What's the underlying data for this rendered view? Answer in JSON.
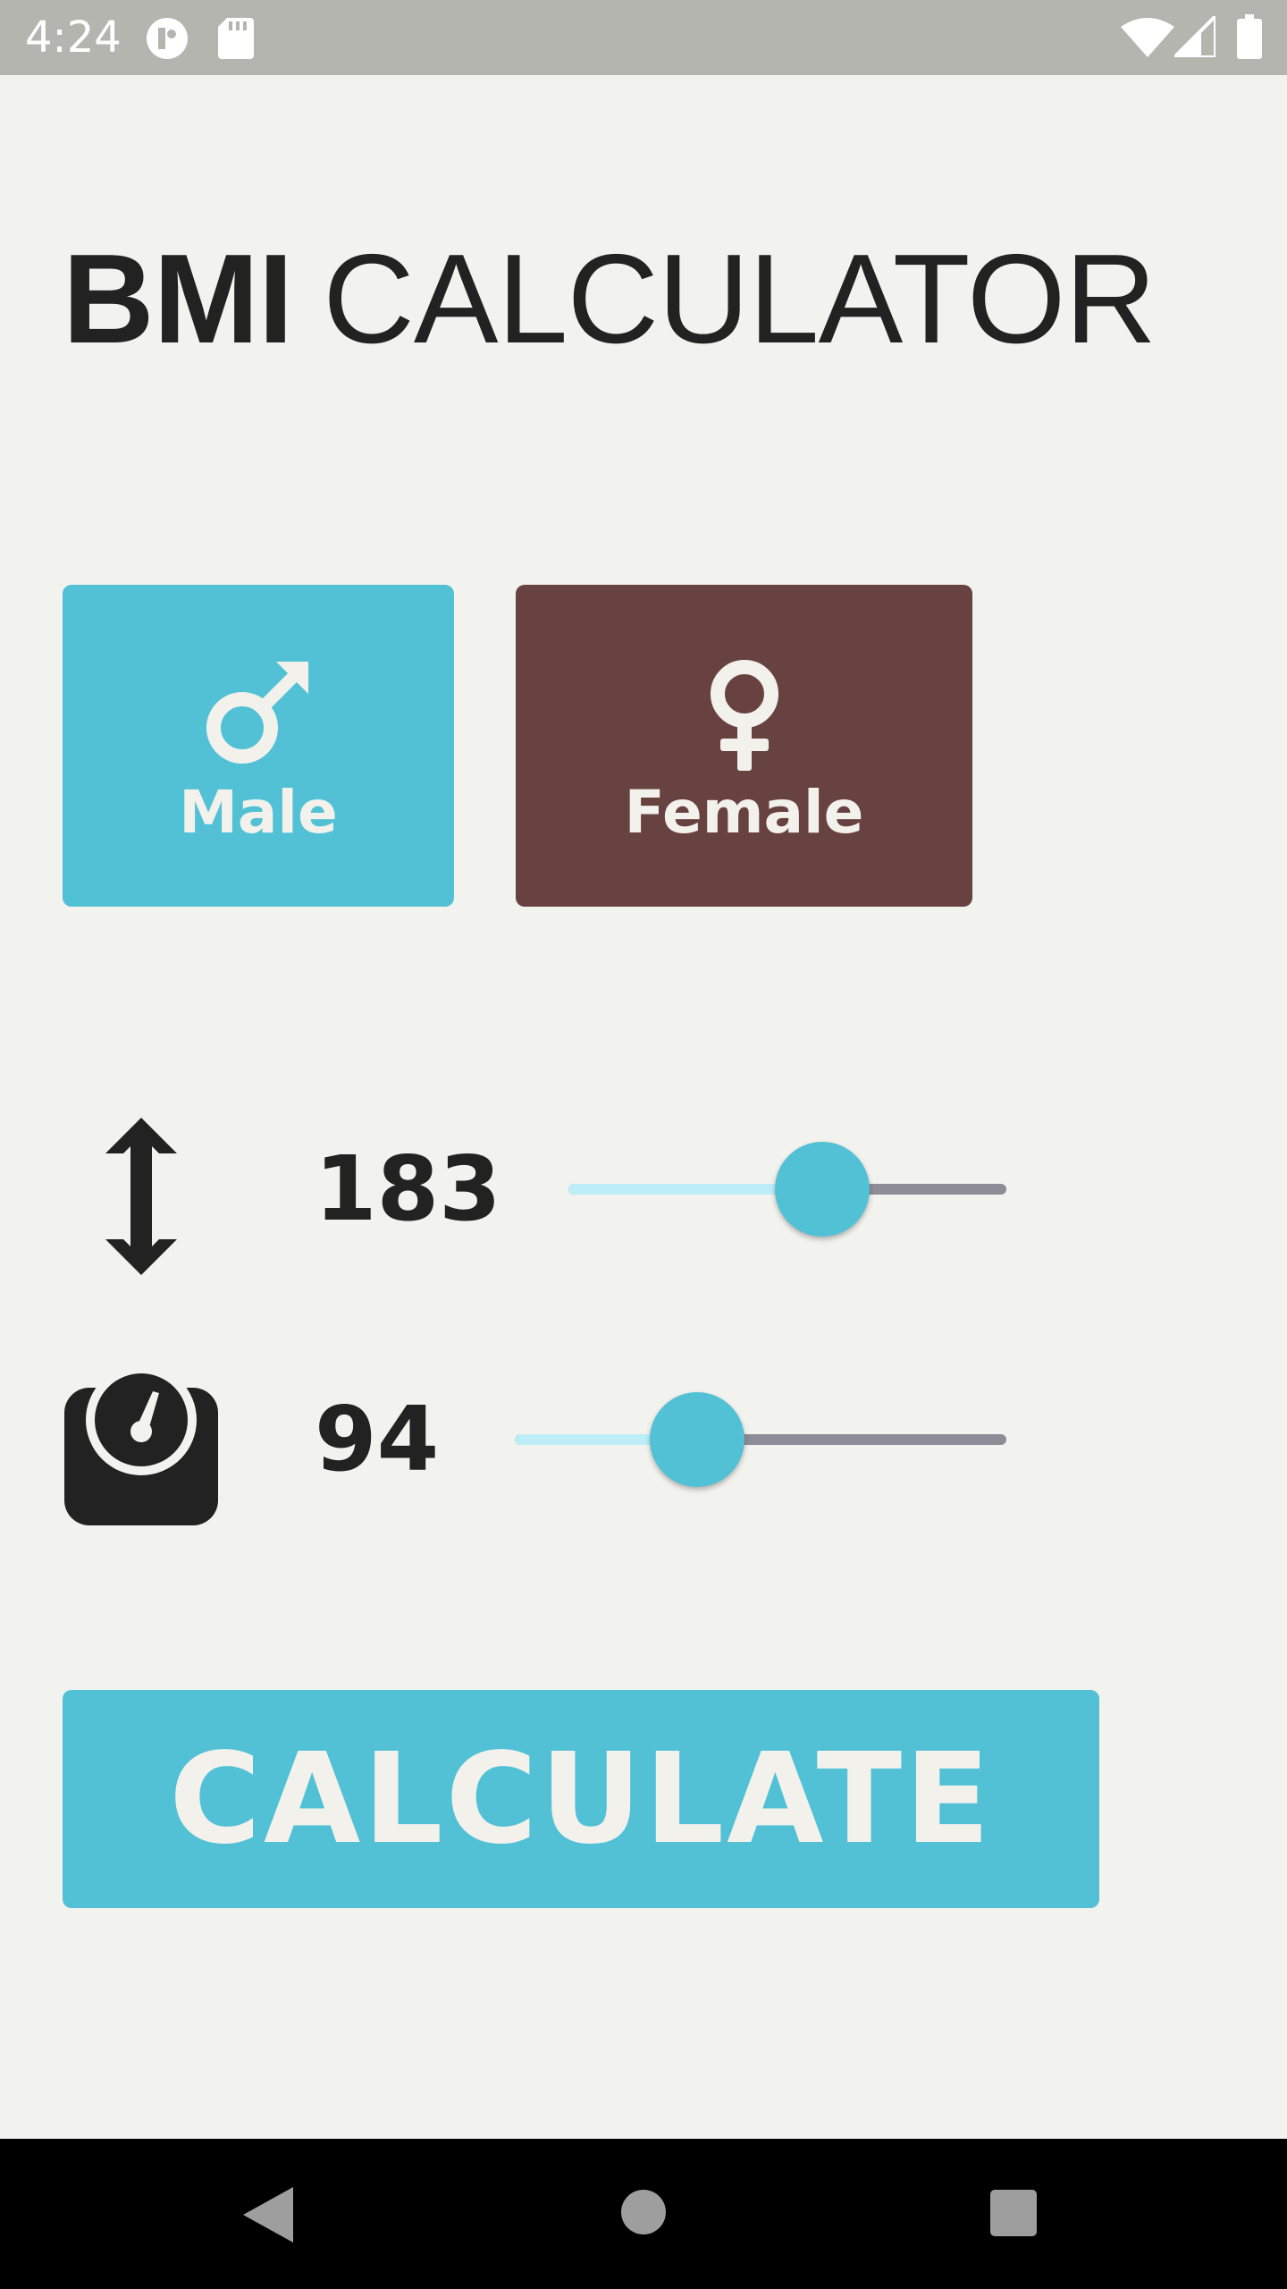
{
  "status_bar": {
    "time": "4:24",
    "icons": [
      "app-notification-icon",
      "sd-card-icon",
      "wifi-icon",
      "signal-icon",
      "battery-icon"
    ]
  },
  "title": {
    "bold": "BMI",
    "light": "CALCULATOR"
  },
  "gender": {
    "male_label": "Male",
    "female_label": "Female",
    "male_color": "#52c1d5",
    "female_color": "#684241"
  },
  "height": {
    "icon": "height-arrows-icon",
    "value": "183",
    "slider_fraction": 0.58
  },
  "weight": {
    "icon": "scale-icon",
    "value": "94",
    "slider_fraction": 0.37
  },
  "calculate_label": "CALCULATE",
  "colors": {
    "accent": "#52c1d5",
    "background": "#f2f2ee",
    "text": "#222222",
    "slider_active": "#bdeef7",
    "slider_inactive": "#8e8c96"
  },
  "nav_bar": {
    "icons": [
      "back-icon",
      "home-icon",
      "recents-icon"
    ]
  }
}
